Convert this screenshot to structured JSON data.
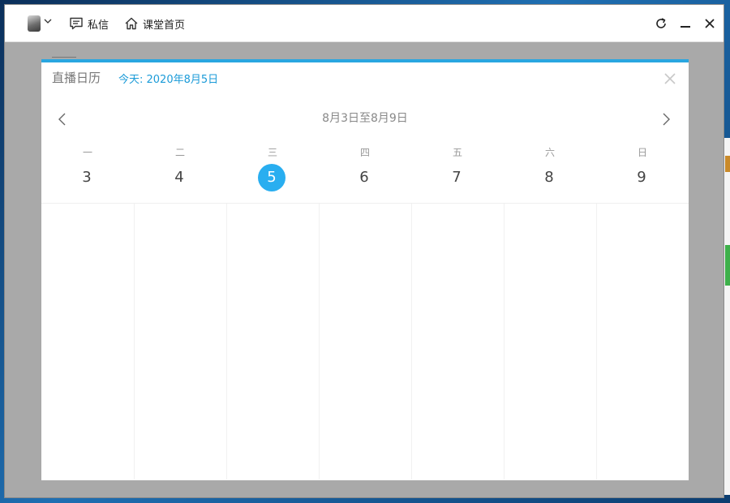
{
  "titlebar": {
    "messages_label": "私信",
    "home_label": "课堂首页",
    "icons": [
      "avatar",
      "chevron-down-icon",
      "message-icon",
      "home-icon",
      "refresh-icon",
      "minimize-icon",
      "close-icon"
    ]
  },
  "dialog": {
    "title": "直播日历",
    "today_label": "今天: 2020年8月5日",
    "range_label": "8月3日至8月9日",
    "accent_color": "#2aa6e0",
    "days": [
      {
        "weekday": "一",
        "date": "3",
        "today": false
      },
      {
        "weekday": "二",
        "date": "4",
        "today": false
      },
      {
        "weekday": "三",
        "date": "5",
        "today": true
      },
      {
        "weekday": "四",
        "date": "6",
        "today": false
      },
      {
        "weekday": "五",
        "date": "7",
        "today": false
      },
      {
        "weekday": "六",
        "date": "8",
        "today": false
      },
      {
        "weekday": "日",
        "date": "9",
        "today": false
      }
    ]
  },
  "colors": {
    "today_highlight": "#29aef0",
    "today_text": "#1b9bd8",
    "overlay": "#a9a9a9"
  }
}
